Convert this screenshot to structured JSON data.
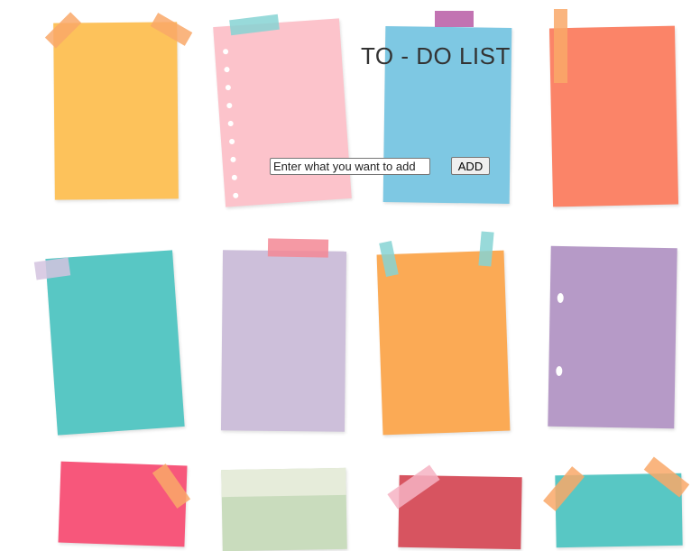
{
  "app": {
    "title": "TO - DO LIST"
  },
  "form": {
    "input_placeholder": "Enter what you want to add",
    "add_label": "ADD"
  },
  "colors": {
    "note_yellow": "#fdc25b",
    "note_pink": "#fcc3cb",
    "note_blue": "#7ec8e3",
    "note_coral": "#fb8468",
    "note_teal": "#58c7c4",
    "note_lilac": "#cdbfda",
    "note_orange": "#fbaa55",
    "note_purple": "#b69ac7",
    "note_red": "#f7577b",
    "note_sage": "#c9dcbd",
    "note_darkred": "#d75460",
    "tape_teal": "#86d3d3",
    "tape_orange": "#f9a869",
    "tape_pink": "#f38794",
    "tape_purple": "#b75aa5"
  }
}
